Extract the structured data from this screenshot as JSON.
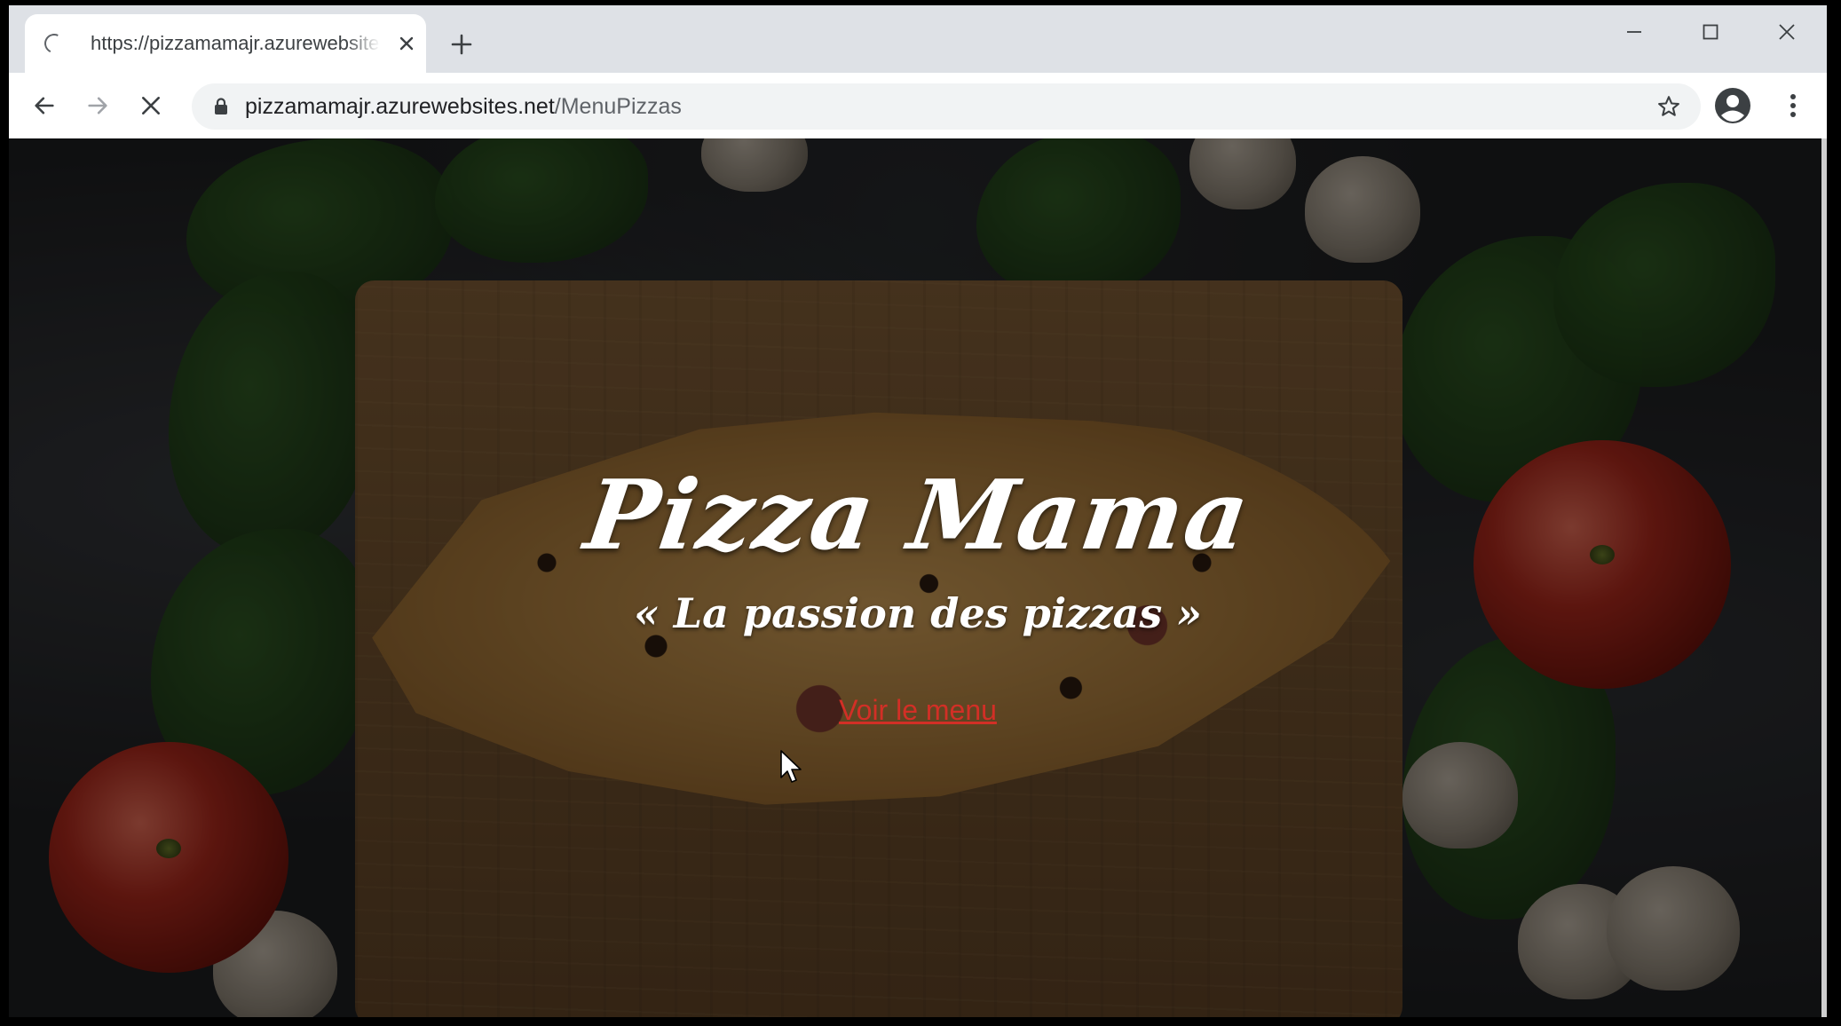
{
  "browser": {
    "tab": {
      "title": "https://pizzamamajr.azurewebsites.net/MenuPizzas",
      "state": "loading"
    },
    "address_bar": {
      "host": "pizzamamajr.azurewebsites.net",
      "path": "/MenuPizzas"
    },
    "icons": {
      "back": "arrow-left-icon",
      "forward": "arrow-right-icon",
      "stop": "close-icon",
      "lock": "lock-icon",
      "bookmark": "star-icon",
      "profile": "account-circle-icon",
      "menu": "more-vert-icon"
    }
  },
  "page": {
    "title": "Pizza Mama",
    "tagline": "« La passion des pizzas »",
    "cta_label": "Voir le menu"
  },
  "colors": {
    "link": "#d22f26",
    "chrome_frame": "#dee1e6",
    "toolbar": "#ffffff",
    "omnibox": "#f1f3f4"
  }
}
